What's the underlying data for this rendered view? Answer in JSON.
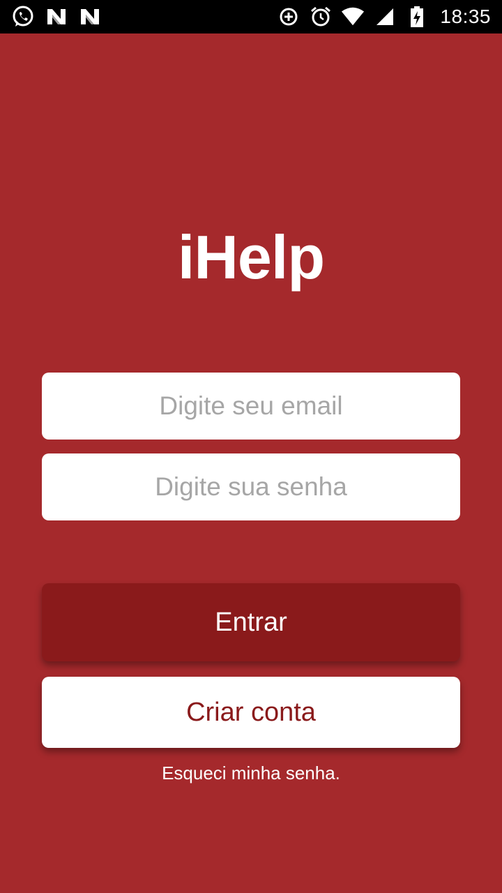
{
  "status_bar": {
    "time": "18:35",
    "left_icons": [
      "whatsapp-icon",
      "n-notification-icon",
      "n-notification-icon"
    ],
    "right_icons": [
      "data-saver-icon",
      "alarm-icon",
      "wifi-icon",
      "signal-icon",
      "battery-charging-icon"
    ]
  },
  "app": {
    "title": "iHelp",
    "email_placeholder": "Digite seu email",
    "password_placeholder": "Digite sua senha",
    "login_label": "Entrar",
    "create_account_label": "Criar conta",
    "forgot_password_label": "Esqueci minha senha."
  },
  "colors": {
    "background": "#a5292c",
    "primary_button": "#8a1a1b",
    "secondary_button": "#ffffff",
    "placeholder": "#a6a6a6"
  }
}
